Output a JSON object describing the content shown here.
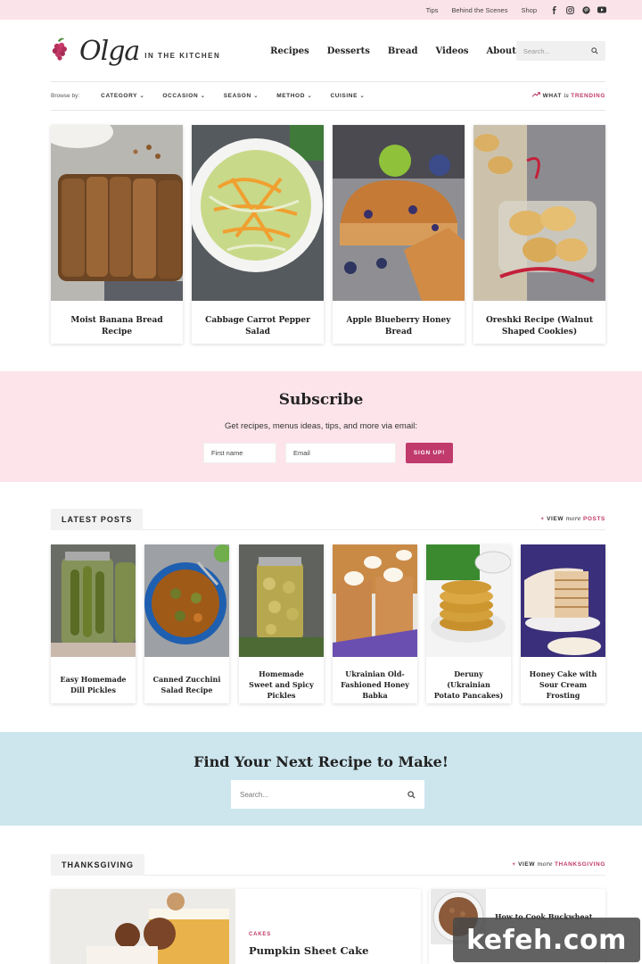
{
  "topbar": {
    "links": [
      "Tips",
      "Behind the Scenes",
      "Shop"
    ],
    "social_icons": [
      "facebook-icon",
      "instagram-icon",
      "pinterest-icon",
      "youtube-icon"
    ]
  },
  "header": {
    "logo_script": "Olga",
    "logo_sub": "IN THE KITCHEN",
    "nav": [
      "Recipes",
      "Desserts",
      "Bread",
      "Videos",
      "About"
    ],
    "search_placeholder": "Search..."
  },
  "browse": {
    "label": "Browse by:",
    "categories": [
      "CATEGORY",
      "OCCASION",
      "SEASON",
      "METHOD",
      "CUISINE"
    ],
    "trending_prefix": "WHAT",
    "trending_is": "is",
    "trending_word": "TRENDING"
  },
  "featured": [
    {
      "title": "Moist Banana Bread Recipe"
    },
    {
      "title": "Cabbage Carrot Pepper Salad"
    },
    {
      "title": "Apple Blueberry Honey Bread"
    },
    {
      "title": "Oreshki Recipe (Walnut Shaped Cookies)"
    }
  ],
  "subscribe": {
    "title": "Subscribe",
    "text": "Get recipes, menus ideas, tips, and more via email:",
    "first_name_placeholder": "First name",
    "email_placeholder": "Email",
    "button": "SIGN UP!"
  },
  "latest": {
    "heading": "LATEST POSTS",
    "more_prefix": "VIEW",
    "more_italic": "more",
    "more_word": "POSTS",
    "posts": [
      {
        "title": "Easy Homemade Dill Pickles"
      },
      {
        "title": "Canned Zucchini Salad Recipe"
      },
      {
        "title": "Homemade Sweet and Spicy Pickles"
      },
      {
        "title": "Ukrainian Old-Fashioned Honey Babka"
      },
      {
        "title": "Deruny (Ukrainian Potato Pancakes)"
      },
      {
        "title": "Honey Cake with Sour Cream Frosting"
      }
    ]
  },
  "find": {
    "title": "Find Your Next Recipe to Make!",
    "placeholder": "Search..."
  },
  "thanksgiving": {
    "heading": "THANKSGIVING",
    "more_prefix": "VIEW",
    "more_italic": "more",
    "more_word": "THANKSGIVING",
    "big_category": "CAKES",
    "big_title": "Pumpkin Sheet Cake",
    "small_title": "How to Cook Buckwheat"
  },
  "watermark": "kefeh.com",
  "colors": {
    "accent": "#c03a6b",
    "topbar_bg": "#fbe3ea",
    "subscribe_bg": "#fde4eb",
    "find_bg": "#cde6ee"
  }
}
